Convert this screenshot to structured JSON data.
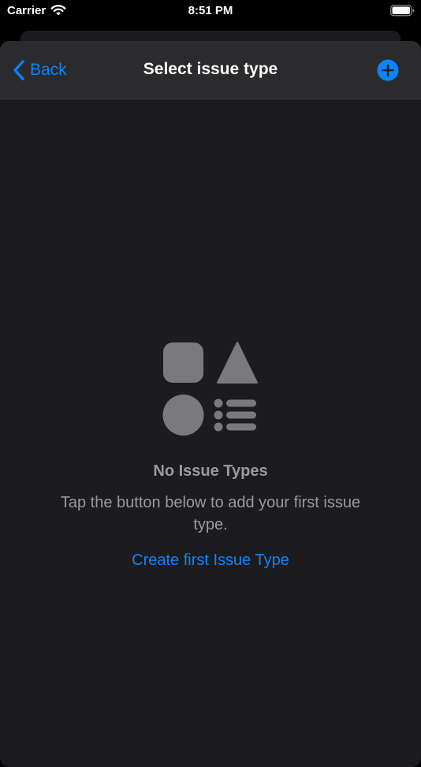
{
  "status_bar": {
    "carrier": "Carrier",
    "time": "8:51 PM",
    "wifi_icon": "wifi-icon",
    "battery_icon": "battery-icon"
  },
  "nav": {
    "back_label": "Back",
    "title": "Select issue type",
    "add_icon": "plus-circle-icon"
  },
  "empty_state": {
    "illustration_icon": "shapes-icon",
    "title": "No Issue Types",
    "message": "Tap the button below to add your first issue type.",
    "action_label": "Create first Issue Type"
  },
  "colors": {
    "accent": "#0a84ff",
    "background": "#1c1c1e",
    "nav_background": "#2b2b2d",
    "secondary_text": "#9a9a9e",
    "illustration": "#7a7a7c"
  }
}
